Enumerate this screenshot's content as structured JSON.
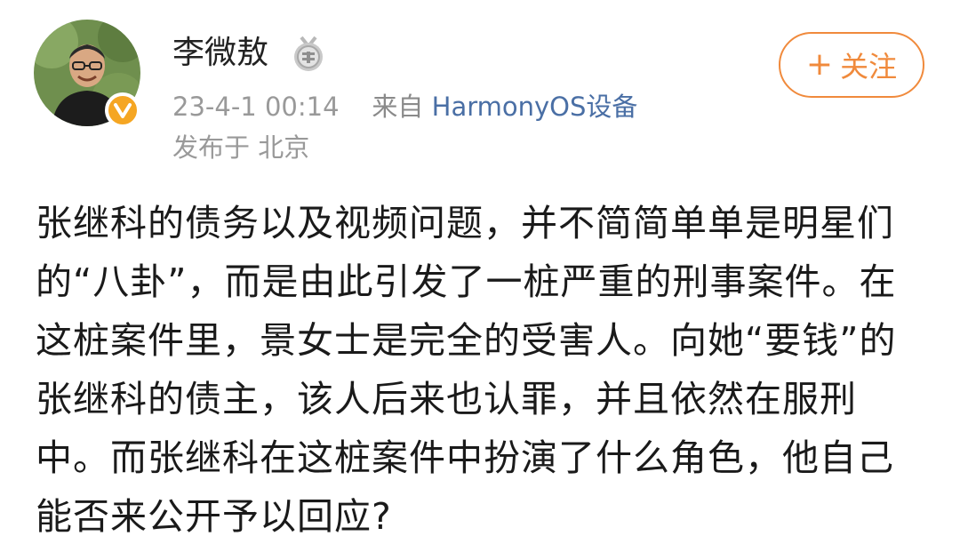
{
  "post": {
    "author": {
      "name": "李微敖",
      "medal_icon": "medal-icon",
      "verified_icon": "verified-v-icon",
      "badge_color": "#f5a623"
    },
    "meta": {
      "time": "23-4-1 00:14",
      "source_prefix": "来自",
      "device": "HarmonyOS设备",
      "location": "发布于 北京"
    },
    "follow_button": {
      "plus": "+",
      "label": "关注",
      "color": "#f08a3c"
    },
    "content": "张继科的债务以及视频问题，并不简简单单是明星们的“八卦”，而是由此引发了一桩严重的刑事案件。在这桩案件里，景女士是完全的受害人。向她“要钱”的张继科的债主，该人后来也认罪，并且依然在服刑中。而张继科在这桩案件中扮演了什么角色，他自己能否来公开予以回应?"
  }
}
